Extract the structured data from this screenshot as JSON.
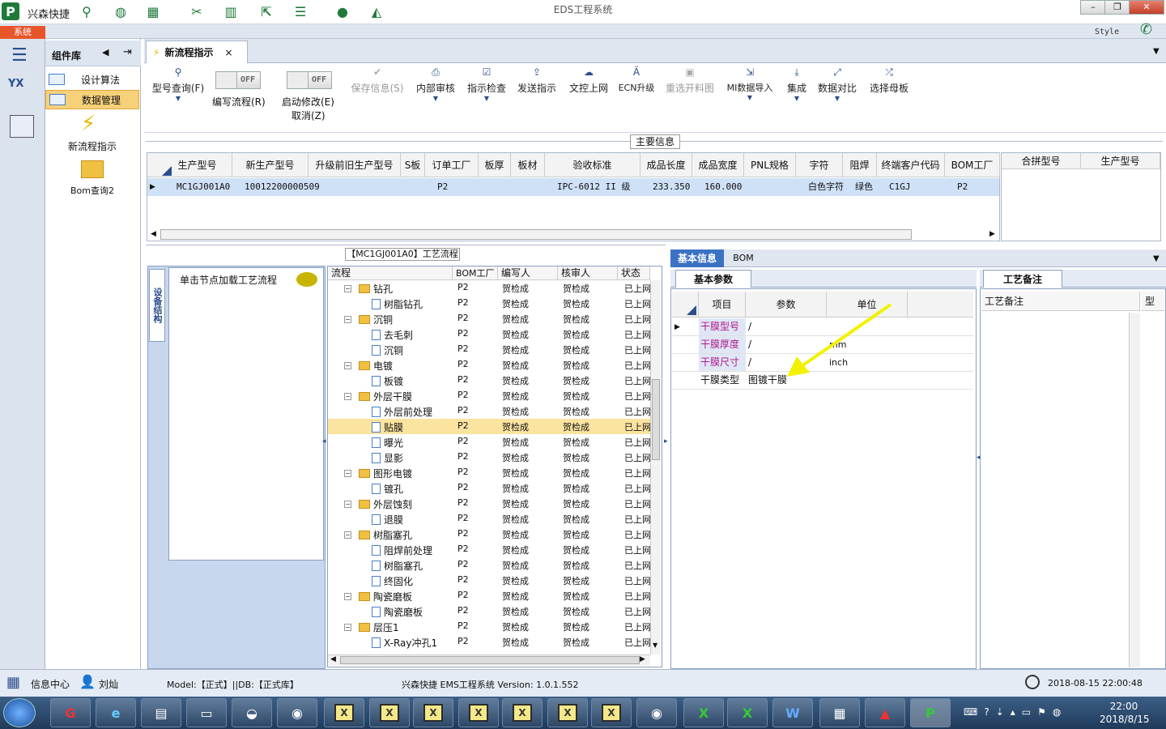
{
  "app": {
    "name": "兴森快捷",
    "window_title": "EDS工程系统",
    "menu_tab": "系统",
    "style_label": "Style"
  },
  "complib": {
    "title": "组件库",
    "items": [
      {
        "label": "设计算法"
      },
      {
        "label": "数据管理"
      }
    ],
    "big_items": [
      {
        "label": "新流程指示"
      },
      {
        "label": "Bom查询2"
      }
    ]
  },
  "doc_tab": {
    "label": "新流程指示"
  },
  "toolbar": {
    "buttons": [
      {
        "label": "型号查询(F)",
        "icon": "search-icon"
      },
      {
        "label": "保存信息(S)",
        "icon": "check-icon"
      },
      {
        "label": "内部审核",
        "icon": "printer-icon"
      },
      {
        "label": "指示检查",
        "icon": "check-box-icon"
      },
      {
        "label": "发送指示",
        "icon": "upload-icon"
      },
      {
        "label": "文控上网",
        "icon": "cloud-icon"
      },
      {
        "label": "ECN升级",
        "icon": "ecn-icon"
      },
      {
        "label": "重选开料图",
        "icon": "image-icon"
      },
      {
        "label": "MI数据导入",
        "icon": "import-icon"
      },
      {
        "label": "集成",
        "icon": "download-icon"
      },
      {
        "label": "数据对比",
        "icon": "compare-icon"
      },
      {
        "label": "选择母板",
        "icon": "shuffle-icon"
      }
    ],
    "toggle_write": {
      "label": "编写流程(R)",
      "state": "OFF"
    },
    "toggle_edit": {
      "label1": "启动修改(E)",
      "label2": "取消(Z)",
      "state": "OFF"
    }
  },
  "main_info": {
    "title": "主要信息",
    "columns": [
      "生产型号",
      "新生产型号",
      "升级前旧生产型号",
      "S板",
      "订单工厂",
      "板厚",
      "板材",
      "验收标准",
      "成品长度",
      "成品宽度",
      "PNL规格",
      "字符",
      "阻焊",
      "终端客户代码",
      "BOM工厂"
    ],
    "row": [
      "MC1GJ001A0",
      "10012200000509",
      "",
      "",
      "P2",
      "",
      "",
      "IPC-6012 II 级",
      "233.350",
      "160.000",
      "",
      "白色字符",
      "绿色",
      "C1GJ",
      "P2"
    ],
    "side_columns": [
      "合拼型号",
      "生产型号"
    ]
  },
  "process": {
    "title": "【MC1GJ001A0】工艺流程",
    "vertical_tab": "设备结构",
    "hint": "单击节点加载工艺流程",
    "columns": [
      "流程",
      "BOM工厂",
      "编写人",
      "核审人",
      "状态"
    ],
    "rows": [
      {
        "name": "钻孔",
        "folder": true,
        "factory": "P2",
        "writer": "贺检成",
        "reviewer": "贺检成",
        "status": "已上网"
      },
      {
        "name": "树脂钻孔",
        "folder": false,
        "factory": "P2",
        "writer": "贺检成",
        "reviewer": "贺检成",
        "status": "已上网"
      },
      {
        "name": "沉铜",
        "folder": true,
        "factory": "P2",
        "writer": "贺检成",
        "reviewer": "贺检成",
        "status": "已上网"
      },
      {
        "name": "去毛刺",
        "folder": false,
        "factory": "P2",
        "writer": "贺检成",
        "reviewer": "贺检成",
        "status": "已上网"
      },
      {
        "name": "沉铜",
        "folder": false,
        "factory": "P2",
        "writer": "贺检成",
        "reviewer": "贺检成",
        "status": "已上网"
      },
      {
        "name": "电镀",
        "folder": true,
        "factory": "P2",
        "writer": "贺检成",
        "reviewer": "贺检成",
        "status": "已上网"
      },
      {
        "name": "板镀",
        "folder": false,
        "factory": "P2",
        "writer": "贺检成",
        "reviewer": "贺检成",
        "status": "已上网"
      },
      {
        "name": "外层干膜",
        "folder": true,
        "factory": "P2",
        "writer": "贺检成",
        "reviewer": "贺检成",
        "status": "已上网"
      },
      {
        "name": "外层前处理",
        "folder": false,
        "factory": "P2",
        "writer": "贺检成",
        "reviewer": "贺检成",
        "status": "已上网"
      },
      {
        "name": "贴膜",
        "folder": false,
        "factory": "P2",
        "writer": "贺检成",
        "reviewer": "贺检成",
        "status": "已上网",
        "selected": true
      },
      {
        "name": "曝光",
        "folder": false,
        "factory": "P2",
        "writer": "贺检成",
        "reviewer": "贺检成",
        "status": "已上网"
      },
      {
        "name": "显影",
        "folder": false,
        "factory": "P2",
        "writer": "贺检成",
        "reviewer": "贺检成",
        "status": "已上网"
      },
      {
        "name": "图形电镀",
        "folder": true,
        "factory": "P2",
        "writer": "贺检成",
        "reviewer": "贺检成",
        "status": "已上网"
      },
      {
        "name": "镀孔",
        "folder": false,
        "factory": "P2",
        "writer": "贺检成",
        "reviewer": "贺检成",
        "status": "已上网"
      },
      {
        "name": "外层蚀刻",
        "folder": true,
        "factory": "P2",
        "writer": "贺检成",
        "reviewer": "贺检成",
        "status": "已上网"
      },
      {
        "name": "退膜",
        "folder": false,
        "factory": "P2",
        "writer": "贺检成",
        "reviewer": "贺检成",
        "status": "已上网"
      },
      {
        "name": "树脂塞孔",
        "folder": true,
        "factory": "P2",
        "writer": "贺检成",
        "reviewer": "贺检成",
        "status": "已上网"
      },
      {
        "name": "阻焊前处理",
        "folder": false,
        "factory": "P2",
        "writer": "贺检成",
        "reviewer": "贺检成",
        "status": "已上网"
      },
      {
        "name": "树脂塞孔",
        "folder": false,
        "factory": "P2",
        "writer": "贺检成",
        "reviewer": "贺检成",
        "status": "已上网"
      },
      {
        "name": "终固化",
        "folder": false,
        "factory": "P2",
        "writer": "贺检成",
        "reviewer": "贺检成",
        "status": "已上网"
      },
      {
        "name": "陶瓷磨板",
        "folder": true,
        "factory": "P2",
        "writer": "贺检成",
        "reviewer": "贺检成",
        "status": "已上网"
      },
      {
        "name": "陶瓷磨板",
        "folder": false,
        "factory": "P2",
        "writer": "贺检成",
        "reviewer": "贺检成",
        "status": "已上网"
      },
      {
        "name": "层压1",
        "folder": true,
        "factory": "P2",
        "writer": "贺检成",
        "reviewer": "贺检成",
        "status": "已上网"
      },
      {
        "name": "X-Ray冲孔1",
        "folder": false,
        "factory": "P2",
        "writer": "贺检成",
        "reviewer": "贺检成",
        "status": "已上网"
      }
    ]
  },
  "right": {
    "tabs": [
      "基本信息",
      "BOM"
    ],
    "params_tab": "基本参数",
    "param_columns": [
      "项目",
      "参数",
      "单位"
    ],
    "params": [
      {
        "item": "干膜型号",
        "value": "/",
        "unit": "",
        "highlight": true
      },
      {
        "item": "干膜厚度",
        "value": "/",
        "unit": "mm",
        "highlight": true
      },
      {
        "item": "干膜尺寸",
        "value": "/",
        "unit": "inch",
        "highlight": true
      },
      {
        "item": "干膜类型",
        "value": "图镀干膜",
        "unit": "",
        "highlight": false
      }
    ],
    "memo_tab": "工艺备注",
    "memo_columns": [
      "工艺备注",
      "型"
    ]
  },
  "status": {
    "info_center": "信息中心",
    "user": "刘灿",
    "model": "Model:【正式】||DB:【正式库】",
    "version": "兴森快捷 EMS工程系统 Version: 1.0.1.552",
    "datetime": "2018-08-15 22:00:48"
  },
  "taskbar": {
    "time": "22:00",
    "date": "2018/8/15"
  },
  "colors": {
    "accent": "#3b72c4",
    "selected": "#f7d17a",
    "grid_row": "#cfe1f7",
    "param_key": "#b01a8c",
    "arrow": "#f2f200"
  }
}
